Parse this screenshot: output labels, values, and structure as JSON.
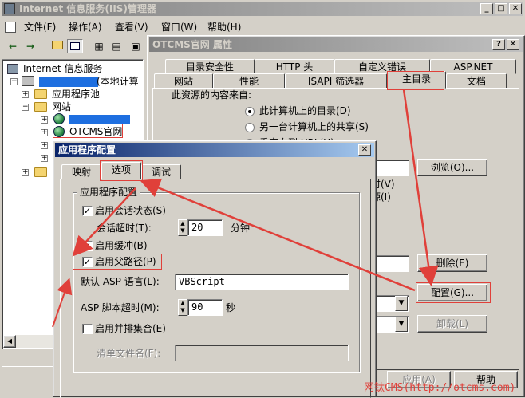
{
  "main_window": {
    "title": "Internet 信息服务(IIS)管理器",
    "menu": [
      "文件(F)",
      "操作(A)",
      "查看(V)",
      "窗口(W)",
      "帮助(H)"
    ],
    "tree": {
      "root": "Internet 信息服务",
      "computer_suffix": "(本地计算",
      "items": [
        "应用程序池",
        "网站",
        "OTCMS官网"
      ]
    }
  },
  "properties_dialog": {
    "title": "OTCMS官网 属性",
    "tabs_row1": [
      "目录安全性",
      "HTTP 头",
      "自定义错误",
      "ASP.NET"
    ],
    "tabs_row2": [
      "网站",
      "性能",
      "ISAPI 筛选器",
      "主目录",
      "文档"
    ],
    "content_source_label": "此资源的内容来自:",
    "radio_options": [
      "此计算机上的目录(D)",
      "另一台计算机上的共享(S)",
      "重定向到 URL(U)"
    ],
    "partial_labels": [
      "时(V)",
      "源(I)"
    ],
    "buttons": {
      "browse": "浏览(O)...",
      "delete": "删除(E)",
      "configure": "配置(G)...",
      "unload": "卸载(L)",
      "apply": "应用(A)",
      "help": "帮助"
    }
  },
  "app_config_dialog": {
    "title": "应用程序配置",
    "tabs": [
      "映射",
      "选项",
      "调试"
    ],
    "active_tab": "选项",
    "group_title": "应用程序配置",
    "enable_session_state": "启用会话状态(S)",
    "session_timeout_label": "会话超时(T):",
    "session_timeout_value": "20",
    "minutes_unit": "分钟",
    "enable_buffering": "启用缓冲(B)",
    "enable_parent_paths": "启用父路径(P)",
    "default_language_label": "默认 ASP 语言(L):",
    "default_language_value": "VBScript",
    "script_timeout_label": "ASP 脚本超时(M):",
    "script_timeout_value": "90",
    "seconds_unit": "秒",
    "enable_side_by_side": "启用并排集合(E)",
    "manifest_label": "清单文件名(F):"
  },
  "watermark": "网钛CMS(http://otcms.com)"
}
